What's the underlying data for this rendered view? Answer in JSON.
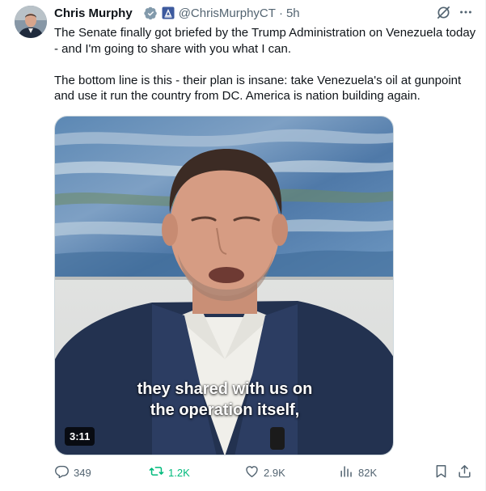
{
  "author": {
    "name": "Chris Murphy",
    "handle": "@ChrisMurphyCT",
    "separator": "·",
    "time": "5h"
  },
  "icons": {
    "verified": "verified-badge-icon",
    "affiliation": "government-affiliation-icon",
    "grok": "grok-icon",
    "more": "more-icon",
    "reply": "reply-icon",
    "retweet": "retweet-icon",
    "like": "like-icon",
    "views": "views-icon",
    "bookmark": "bookmark-icon",
    "share": "share-icon"
  },
  "tweet": {
    "paragraphs": [
      "The Senate finally got briefed by the Trump Administration on Venezuela today - and I'm going to share with you what I can.",
      "The bottom line is this - their plan is insane: take Venezuela's oil at gunpoint and use it run the country from DC. America is nation building again."
    ]
  },
  "video": {
    "caption_line1": "they shared with us on",
    "caption_line2": "the operation itself,",
    "duration": "3:11"
  },
  "actions": {
    "replies": "349",
    "retweets": "1.2K",
    "likes": "2.9K",
    "views": "82K"
  },
  "colors": {
    "text": "#0f1419",
    "muted": "#536471",
    "verified": "#829aab",
    "retweeted": "#00ba7c"
  }
}
